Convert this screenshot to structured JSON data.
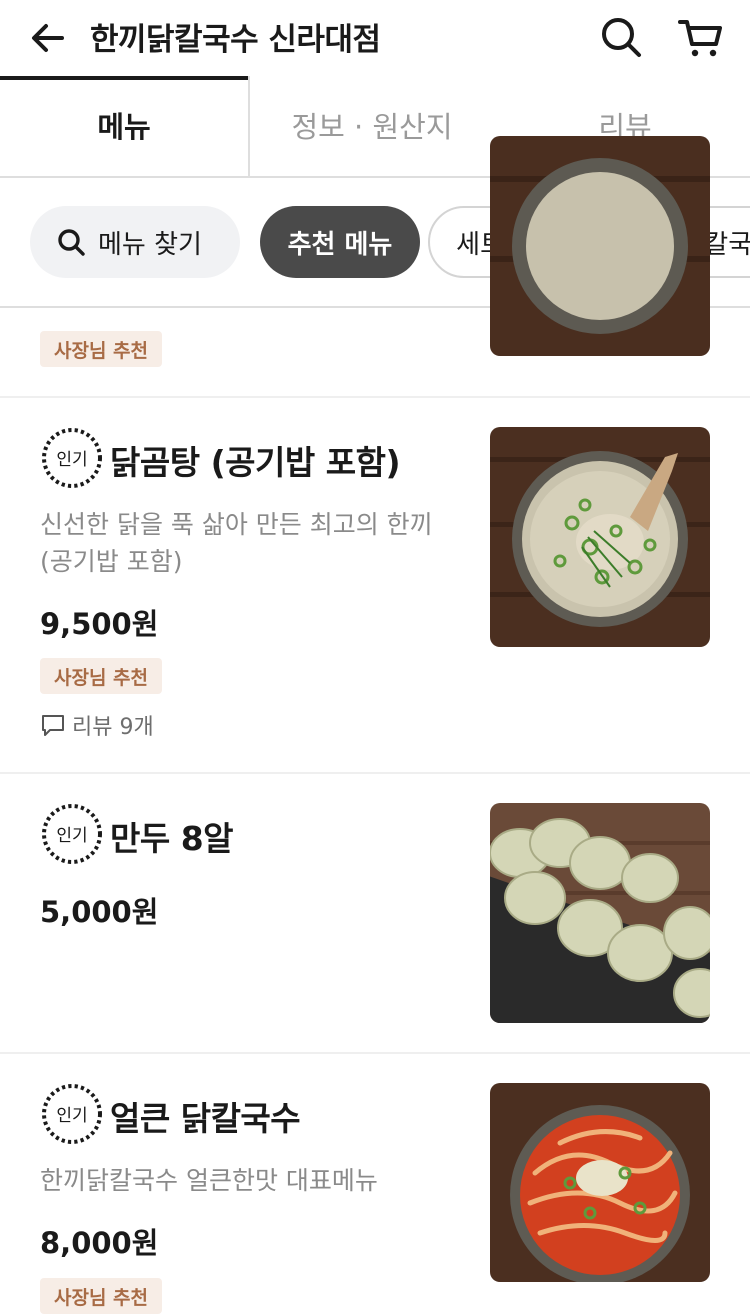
{
  "header": {
    "title": "한끼닭칼국수 신라대점",
    "icons": [
      "arrow-left-icon",
      "search-icon",
      "cart-icon"
    ]
  },
  "tabs": [
    {
      "label": "메뉴",
      "active": true
    },
    {
      "label": "정보 · 원산지",
      "active": false
    },
    {
      "label": "리뷰",
      "active": false
    }
  ],
  "chips": {
    "search_label": "메뉴 찾기",
    "items": [
      {
        "label": "추천 메뉴",
        "selected": true
      },
      {
        "label": "세트메뉴",
        "selected": false
      },
      {
        "label": "한끼 닭 칼국",
        "selected": false
      }
    ]
  },
  "menu": {
    "popular_badge": "인기",
    "owner_pick": "사장님 추천",
    "items": [
      {
        "name": "닭곰탕 (공기밥 포함)",
        "desc_line1": "신선한 닭을 푹 삶아 만든 최고의 한끼",
        "desc_line2": "(공기밥 포함)",
        "price": "9,500원",
        "review": "리뷰 9개"
      },
      {
        "name": "만두 8알",
        "price": "5,000원"
      },
      {
        "name": "얼큰 닭칼국수",
        "desc_line1": "한끼닭칼국수 얼큰한맛 대표메뉴",
        "price": "8,000원"
      }
    ]
  },
  "colors": {
    "owner_tag_bg": "#f7ede6",
    "owner_tag_text": "#a86b45",
    "chip_selected": "#4a4a4a"
  }
}
